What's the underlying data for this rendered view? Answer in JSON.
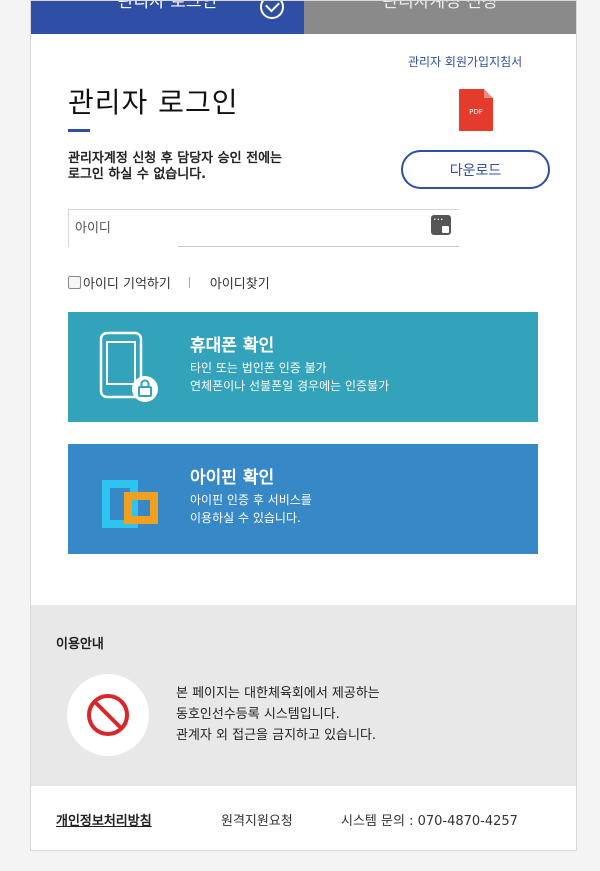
{
  "tabs": {
    "active_label": "관리자 로그인",
    "inactive_label": "관리자계정 신청"
  },
  "guide": {
    "link_label": "관리자 회원가입지침서",
    "pdf_label": "PDF",
    "download_label": "다운로드"
  },
  "login": {
    "title": "관리자 로그인",
    "notice_line1": "관리자계정 신청 후 담당자 승인 전에는",
    "notice_line2": "로그인 하실 수 없습니다.",
    "id_placeholder": "아이디",
    "remember_label": "아이디 기억하기",
    "find_id_label": "아이디찾기"
  },
  "phone_auth": {
    "title": "휴대폰 확인",
    "desc_line1": "타인 또는 법인폰 인증 불가",
    "desc_line2": "연체폰이나 선불폰일 경우에는 인증불가",
    "color": "#33a2bb"
  },
  "ipin_auth": {
    "title": "아이핀 확인",
    "desc_line1": "아이핀 인증 후 서비스를",
    "desc_line2": "이용하실 수 있습니다.",
    "color": "#3688c6"
  },
  "info": {
    "title": "이용안내",
    "line1": "본 페이지는 대한체육회에서 제공하는",
    "line2": "동호인선수등록 시스템입니다.",
    "line3": "관계자 외 접근을 금지하고 있습니다."
  },
  "footer": {
    "privacy_label": "개인정보처리방침",
    "remote_label": "원격지원요청",
    "contact_label": "시스템 문의 : 070-4870-4257"
  },
  "colors": {
    "accent": "#2f4ea6",
    "pdf_red": "#e53b2c",
    "warning_red": "#d8262a"
  },
  "icons": [
    "check-circle-icon",
    "pdf-icon",
    "keypad-icon",
    "phone-lock-icon",
    "ipin-icon",
    "no-entry-icon"
  ]
}
